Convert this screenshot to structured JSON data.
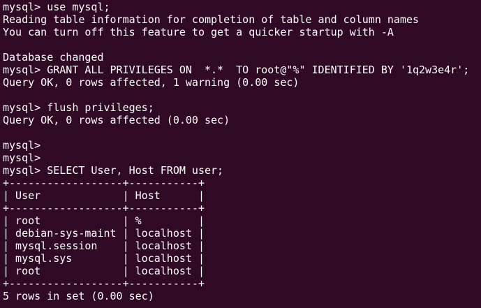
{
  "terminal": {
    "lines": [
      "mysql> use mysql;",
      "Reading table information for completion of table and column names",
      "You can turn off this feature to get a quicker startup with -A",
      "",
      "Database changed",
      "mysql> GRANT ALL PRIVILEGES ON  *.*  TO root@\"%\" IDENTIFIED BY '1q2w3e4r';",
      "Query OK, 0 rows affected, 1 warning (0.00 sec)",
      "",
      "mysql> flush privileges;",
      "Query OK, 0 rows affected (0.00 sec)",
      "",
      "mysql>",
      "mysql>",
      "mysql> SELECT User, Host FROM user;",
      "+------------------+-----------+",
      "| User             | Host      |",
      "+------------------+-----------+",
      "| root             | %         |",
      "| debian-sys-maint | localhost |",
      "| mysql.session    | localhost |",
      "| mysql.sys        | localhost |",
      "| root             | localhost |",
      "+------------------+-----------+",
      "5 rows in set (0.00 sec)"
    ]
  },
  "colors": {
    "background": "#300a24",
    "text": "#ffffff"
  }
}
